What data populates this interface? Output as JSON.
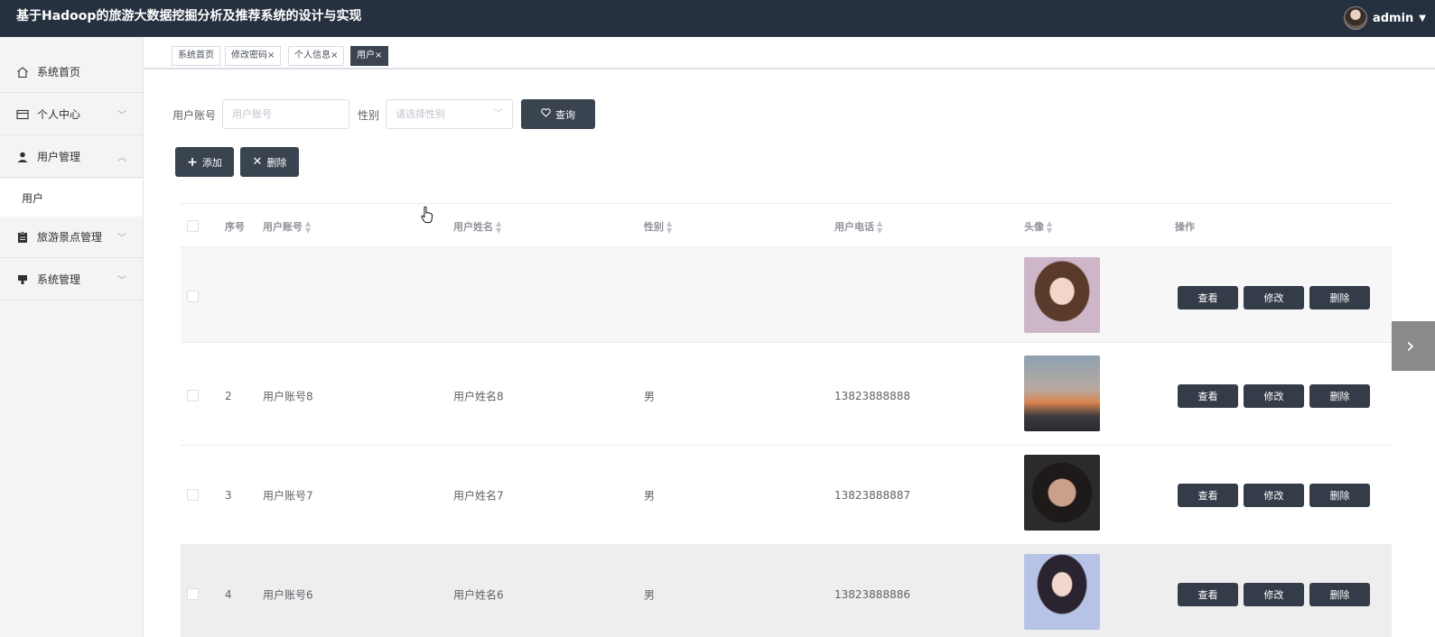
{
  "header": {
    "title": "基于Hadoop的旅游大数据挖掘分析及推荐系统的设计与实现",
    "username": "admin"
  },
  "sidebar": {
    "items": [
      {
        "label": "系统首页",
        "icon": "home-icon"
      },
      {
        "label": "个人中心",
        "icon": "card-icon"
      },
      {
        "label": "用户管理",
        "icon": "user-icon"
      },
      {
        "label": "旅游景点管理",
        "icon": "clipboard-icon"
      },
      {
        "label": "系统管理",
        "icon": "settings-icon"
      }
    ],
    "sub_items": [
      {
        "label": "用户"
      }
    ]
  },
  "tabs": [
    {
      "label": "系统首页",
      "closable": false
    },
    {
      "label": "修改密码",
      "closable": true
    },
    {
      "label": "个人信息",
      "closable": true
    },
    {
      "label": "用户",
      "closable": true,
      "active": true
    }
  ],
  "close_symbol": "×",
  "search": {
    "account_label": "用户账号",
    "account_placeholder": "用户账号",
    "gender_label": "性别",
    "gender_placeholder": "请选择性别",
    "query_button": "查询"
  },
  "actions": {
    "add": "添加",
    "delete": "删除"
  },
  "table": {
    "columns": [
      "序号",
      "用户账号",
      "用户姓名",
      "性别",
      "用户电话",
      "头像",
      "操作"
    ],
    "rows": [
      {
        "index": "",
        "account": "",
        "name": "",
        "gender": "",
        "phone": ""
      },
      {
        "index": "2",
        "account": "用户账号8",
        "name": "用户姓名8",
        "gender": "男",
        "phone": "13823888888"
      },
      {
        "index": "3",
        "account": "用户账号7",
        "name": "用户姓名7",
        "gender": "男",
        "phone": "13823888887"
      },
      {
        "index": "4",
        "account": "用户账号6",
        "name": "用户姓名6",
        "gender": "男",
        "phone": "13823888886"
      }
    ],
    "row_buttons": {
      "view": "查看",
      "edit": "修改",
      "delete": "删除"
    }
  },
  "side_handle_symbol": "›"
}
